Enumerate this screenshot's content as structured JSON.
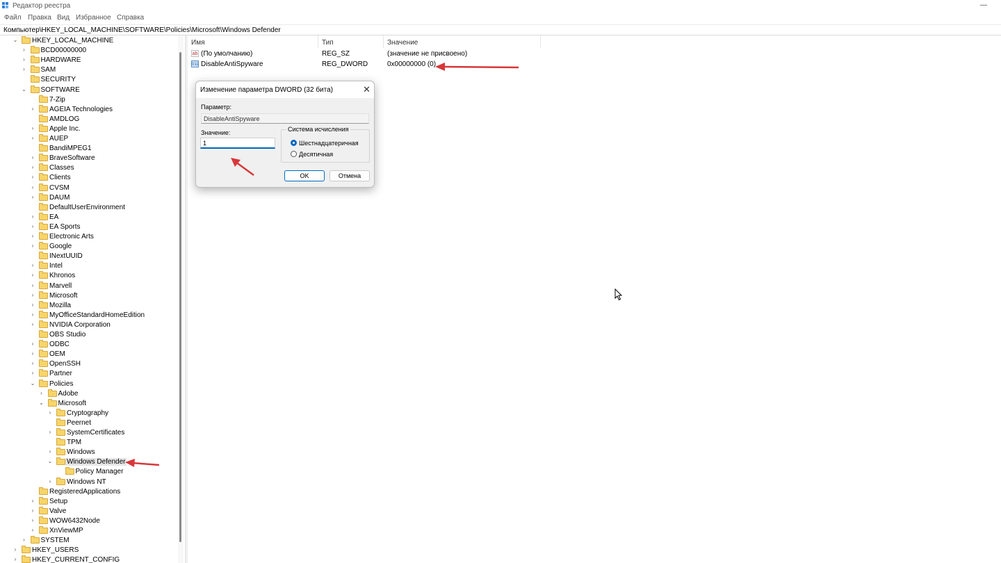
{
  "window": {
    "title": "Редактор реестра",
    "minimize_glyph": "—"
  },
  "menu": [
    "Файл",
    "Правка",
    "Вид",
    "Избранное",
    "Справка"
  ],
  "address": "Компьютер\\HKEY_LOCAL_MACHINE\\SOFTWARE\\Policies\\Microsoft\\Windows Defender",
  "tree": [
    {
      "label": "HKEY_LOCAL_MACHINE",
      "depth": 1,
      "exp": "open"
    },
    {
      "label": "BCD00000000",
      "depth": 2,
      "exp": "closed"
    },
    {
      "label": "HARDWARE",
      "depth": 2,
      "exp": "closed"
    },
    {
      "label": "SAM",
      "depth": 2,
      "exp": "closed"
    },
    {
      "label": "SECURITY",
      "depth": 2,
      "exp": "none"
    },
    {
      "label": "SOFTWARE",
      "depth": 2,
      "exp": "open"
    },
    {
      "label": "7-Zip",
      "depth": 3,
      "exp": "none"
    },
    {
      "label": "AGEIA Technologies",
      "depth": 3,
      "exp": "closed"
    },
    {
      "label": "AMDLOG",
      "depth": 3,
      "exp": "none"
    },
    {
      "label": "Apple Inc.",
      "depth": 3,
      "exp": "closed"
    },
    {
      "label": "AUEP",
      "depth": 3,
      "exp": "closed"
    },
    {
      "label": "BandiMPEG1",
      "depth": 3,
      "exp": "none"
    },
    {
      "label": "BraveSoftware",
      "depth": 3,
      "exp": "closed"
    },
    {
      "label": "Classes",
      "depth": 3,
      "exp": "closed"
    },
    {
      "label": "Clients",
      "depth": 3,
      "exp": "closed"
    },
    {
      "label": "CVSM",
      "depth": 3,
      "exp": "closed"
    },
    {
      "label": "DAUM",
      "depth": 3,
      "exp": "closed"
    },
    {
      "label": "DefaultUserEnvironment",
      "depth": 3,
      "exp": "none"
    },
    {
      "label": "EA",
      "depth": 3,
      "exp": "closed"
    },
    {
      "label": "EA Sports",
      "depth": 3,
      "exp": "closed"
    },
    {
      "label": "Electronic Arts",
      "depth": 3,
      "exp": "closed"
    },
    {
      "label": "Google",
      "depth": 3,
      "exp": "closed"
    },
    {
      "label": "INextUUID",
      "depth": 3,
      "exp": "none"
    },
    {
      "label": "Intel",
      "depth": 3,
      "exp": "closed"
    },
    {
      "label": "Khronos",
      "depth": 3,
      "exp": "closed"
    },
    {
      "label": "Marvell",
      "depth": 3,
      "exp": "closed"
    },
    {
      "label": "Microsoft",
      "depth": 3,
      "exp": "closed"
    },
    {
      "label": "Mozilla",
      "depth": 3,
      "exp": "closed"
    },
    {
      "label": "MyOfficeStandardHomeEdition",
      "depth": 3,
      "exp": "closed"
    },
    {
      "label": "NVIDIA Corporation",
      "depth": 3,
      "exp": "closed"
    },
    {
      "label": "OBS Studio",
      "depth": 3,
      "exp": "none"
    },
    {
      "label": "ODBC",
      "depth": 3,
      "exp": "closed"
    },
    {
      "label": "OEM",
      "depth": 3,
      "exp": "closed"
    },
    {
      "label": "OpenSSH",
      "depth": 3,
      "exp": "closed"
    },
    {
      "label": "Partner",
      "depth": 3,
      "exp": "closed"
    },
    {
      "label": "Policies",
      "depth": 3,
      "exp": "open"
    },
    {
      "label": "Adobe",
      "depth": 4,
      "exp": "closed"
    },
    {
      "label": "Microsoft",
      "depth": 4,
      "exp": "open"
    },
    {
      "label": "Cryptography",
      "depth": 5,
      "exp": "closed"
    },
    {
      "label": "Peernet",
      "depth": 5,
      "exp": "none"
    },
    {
      "label": "SystemCertificates",
      "depth": 5,
      "exp": "closed"
    },
    {
      "label": "TPM",
      "depth": 5,
      "exp": "none"
    },
    {
      "label": "Windows",
      "depth": 5,
      "exp": "closed"
    },
    {
      "label": "Windows Defender",
      "depth": 5,
      "exp": "open",
      "selected": true
    },
    {
      "label": "Policy Manager",
      "depth": 6,
      "exp": "none"
    },
    {
      "label": "Windows NT",
      "depth": 5,
      "exp": "closed"
    },
    {
      "label": "RegisteredApplications",
      "depth": 3,
      "exp": "none"
    },
    {
      "label": "Setup",
      "depth": 3,
      "exp": "closed"
    },
    {
      "label": "Valve",
      "depth": 3,
      "exp": "closed"
    },
    {
      "label": "WOW6432Node",
      "depth": 3,
      "exp": "closed"
    },
    {
      "label": "XnViewMP",
      "depth": 3,
      "exp": "closed"
    },
    {
      "label": "SYSTEM",
      "depth": 2,
      "exp": "closed"
    },
    {
      "label": "HKEY_USERS",
      "depth": 1,
      "exp": "closed"
    },
    {
      "label": "HKEY_CURRENT_CONFIG",
      "depth": 1,
      "exp": "closed"
    }
  ],
  "list": {
    "columns": [
      "Имя",
      "Тип",
      "Значение"
    ],
    "rows": [
      {
        "icon": "string-value-icon",
        "icon_text": "ab",
        "name": "(По умолчанию)",
        "type": "REG_SZ",
        "value": "(значение не присвоено)"
      },
      {
        "icon": "binary-value-icon",
        "icon_text": "011",
        "name": "DisableAntiSpyware",
        "type": "REG_DWORD",
        "value": "0x00000000 (0)"
      }
    ]
  },
  "dialog": {
    "title": "Изменение параметра DWORD (32 бита)",
    "param_label": "Параметр:",
    "param_value": "DisableAntiSpyware",
    "value_label": "Значение:",
    "value": "1",
    "base_label": "Система исчисления",
    "base_options": [
      "Шестнадцатеричная",
      "Десятичная"
    ],
    "base_selected": "Шестнадцатеричная",
    "ok": "OK",
    "cancel": "Отмена"
  },
  "colors": {
    "annotation_arrow": "#d7373a",
    "accent": "#0067c0",
    "folder": "#f7d56a"
  }
}
